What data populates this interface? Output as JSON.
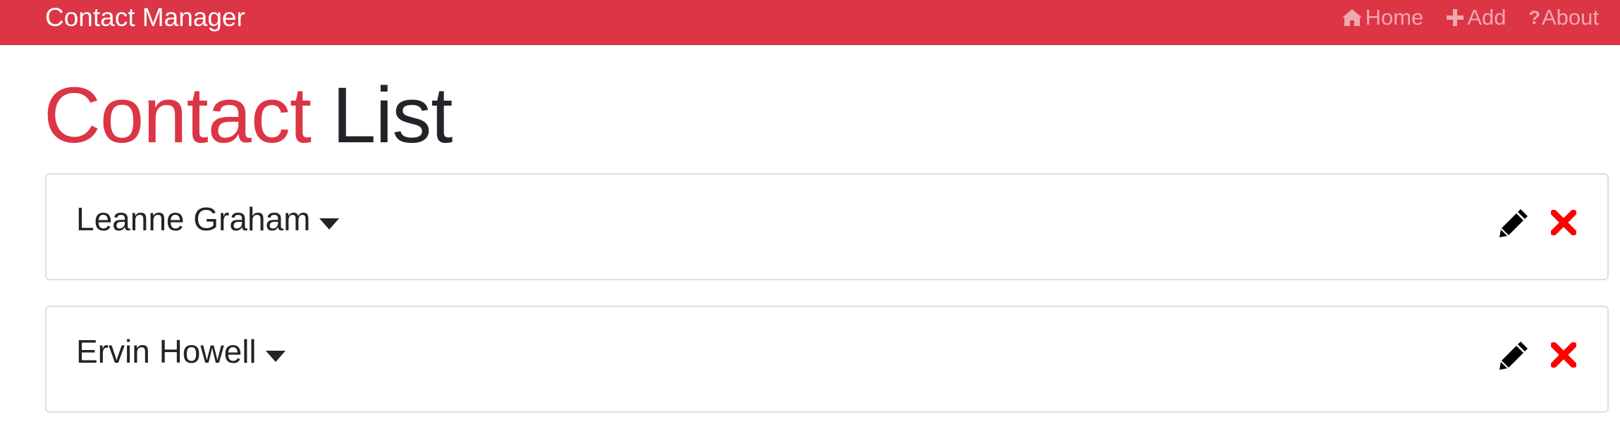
{
  "navbar": {
    "brand": "Contact Manager",
    "links": [
      {
        "label": "Home",
        "icon": "home-icon"
      },
      {
        "label": "Add",
        "icon": "plus-icon"
      },
      {
        "label": "About",
        "icon": "question-icon"
      }
    ]
  },
  "title": {
    "accent": "Contact",
    "rest": "List"
  },
  "contacts": [
    {
      "name": "Leanne Graham"
    },
    {
      "name": "Ervin Howell"
    }
  ],
  "colors": {
    "accent": "#dc3545",
    "nav_link": "#f1a7af",
    "delete": "#ff0000",
    "text": "#212529"
  }
}
